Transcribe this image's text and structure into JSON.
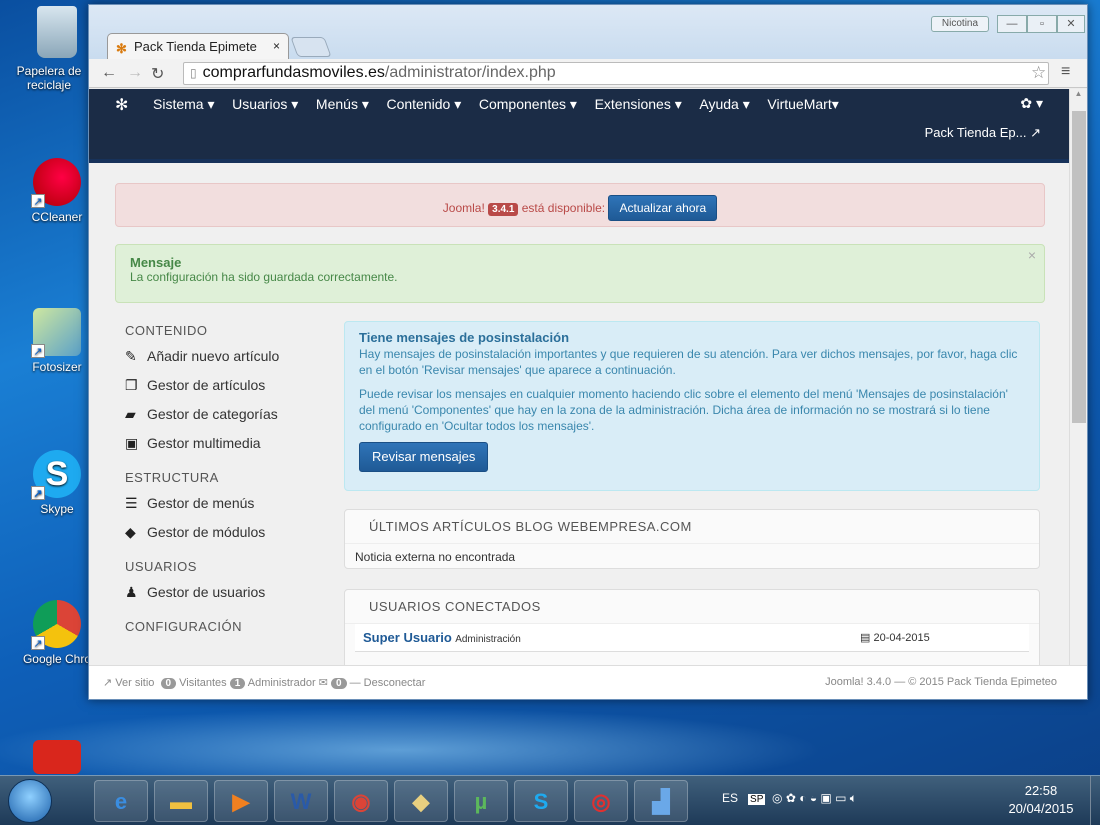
{
  "desktop": {
    "icons": [
      {
        "label": "Papelera de reciclaje",
        "icon": "recycle-bin-icon"
      },
      {
        "label": "CCleaner",
        "icon": "ccleaner-icon"
      },
      {
        "label": "Fotosizer",
        "icon": "fotosizer-icon"
      },
      {
        "label": "Skype",
        "icon": "skype-icon"
      },
      {
        "label": "Google Chro",
        "icon": "chrome-icon"
      }
    ]
  },
  "browser": {
    "tab_title": "Pack Tienda Epimete",
    "tab_close": "×",
    "user_label": "Nicotina",
    "url_domain": "comprarfundasmoviles.es",
    "url_path": "/administrator/index.php"
  },
  "navbar": {
    "items": [
      "Sistema ▾",
      "Usuarios ▾",
      "Menús ▾",
      "Contenido ▾",
      "Componentes ▾",
      "Extensiones ▾",
      "Ayuda ▾",
      "VirtueMart▾"
    ],
    "site_name": "Pack Tienda Ep..."
  },
  "update_alert": {
    "prefix": "Joomla!",
    "version": "3.4.1",
    "suffix": "está disponible:",
    "button": "Actualizar ahora"
  },
  "message": {
    "title": "Mensaje",
    "text": "La configuración ha sido guardada correctamente.",
    "close": "×"
  },
  "sidebar": {
    "sections": [
      {
        "heading": "CONTENIDO",
        "items": [
          {
            "label": "Añadir nuevo artículo",
            "icon": "pencil-icon"
          },
          {
            "label": "Gestor de artículos",
            "icon": "articles-icon"
          },
          {
            "label": "Gestor de categorías",
            "icon": "folder-icon"
          },
          {
            "label": "Gestor multimedia",
            "icon": "media-icon"
          }
        ]
      },
      {
        "heading": "ESTRUCTURA",
        "items": [
          {
            "label": "Gestor de menús",
            "icon": "list-icon"
          },
          {
            "label": "Gestor de módulos",
            "icon": "cube-icon"
          }
        ]
      },
      {
        "heading": "USUARIOS",
        "items": [
          {
            "label": "Gestor de usuarios",
            "icon": "user-icon"
          }
        ]
      },
      {
        "heading": "CONFIGURACIÓN",
        "items": []
      }
    ]
  },
  "postinstall": {
    "title": "Tiene mensajes de posinstalación",
    "p1": "Hay mensajes de posinstalación importantes y que requieren de su atención. Para ver dichos mensajes, por favor, haga clic en el botón 'Revisar mensajes' que aparece a continuación.",
    "p2": "Puede revisar los mensajes en cualquier momento haciendo clic sobre el elemento del menú 'Mensajes de posinstalación' del menú 'Componentes' que hay en la zona de la administración. Dicha área de información no se mostrará si lo tiene configurado en 'Ocultar todos los mensajes'.",
    "button": "Revisar mensajes"
  },
  "latest_articles": {
    "heading": "ÚLTIMOS ARTÍCULOS BLOG WEBEMPRESA.COM",
    "body": "Noticia externa no encontrada"
  },
  "logged_users": {
    "heading": "USUARIOS CONECTADOS",
    "rows": [
      {
        "name": "Super Usuario",
        "role": "Administración",
        "date": "20-04-2015"
      }
    ]
  },
  "status": {
    "view_site": "Ver sitio",
    "visitors_count": "0",
    "visitors": "Visitantes",
    "admins_count": "1",
    "admins": "Administrador",
    "messages_count": "0",
    "logout": "Desconectar",
    "copyright": "Joomla! 3.4.0 — © 2015 Pack Tienda Epimeteo"
  },
  "taskbar": {
    "lang": "ES",
    "tray_sp": "SP",
    "time": "22:58",
    "date": "20/04/2015"
  }
}
